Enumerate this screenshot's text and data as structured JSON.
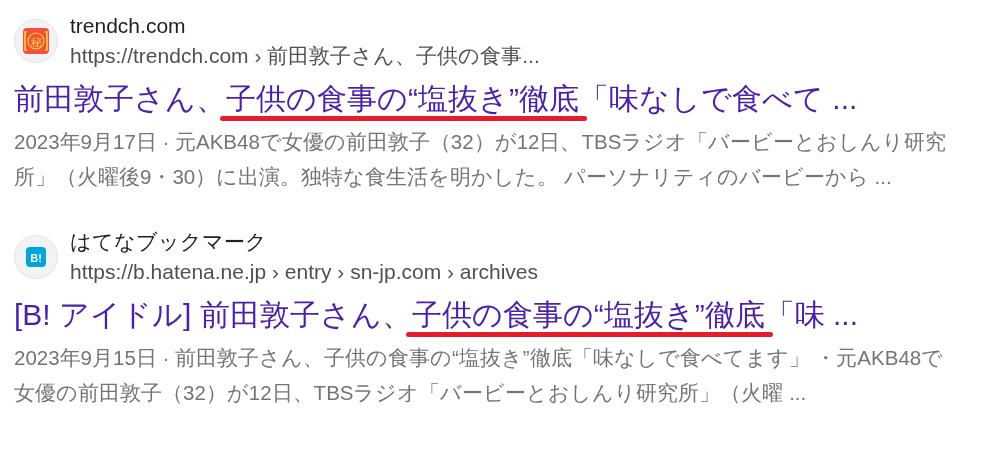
{
  "results": [
    {
      "site": "trendch.com",
      "url": "https://trendch.com › 前田敦子さん、子供の食事...",
      "favicon": {
        "kind": "seal",
        "label": "秘"
      },
      "title": {
        "before": "前田敦子さん、",
        "marked": "子供の食事の“塩抜き”徹底",
        "after": "「味なしで食べて ..."
      },
      "visited": true,
      "snippet": "2023年9月17日 · 元AKB48で女優の前田敦子（32）が12日、TBSラジオ「バービーとおしんり研究所」（火曜後9・30）に出演。独特な食生活を明かした。 パーソナリティのバービーから ..."
    },
    {
      "site": "はてなブックマーク",
      "url": "https://b.hatena.ne.jp › entry › sn-jp.com › archives",
      "favicon": {
        "kind": "badge",
        "label": "B!"
      },
      "title": {
        "before": "[B! アイドル] 前田敦子さん、",
        "marked": "子供の食事の“塩抜き”徹底",
        "after": "「味 ..."
      },
      "visited": true,
      "snippet": "2023年9月15日 · 前田敦子さん、子供の食事の“塩抜き”徹底「味なしで食べてます」 ・元AKB48で女優の前田敦子（32）が12日、TBSラジオ「バービーとおしんり研究所」（火曜 ..."
    }
  ]
}
